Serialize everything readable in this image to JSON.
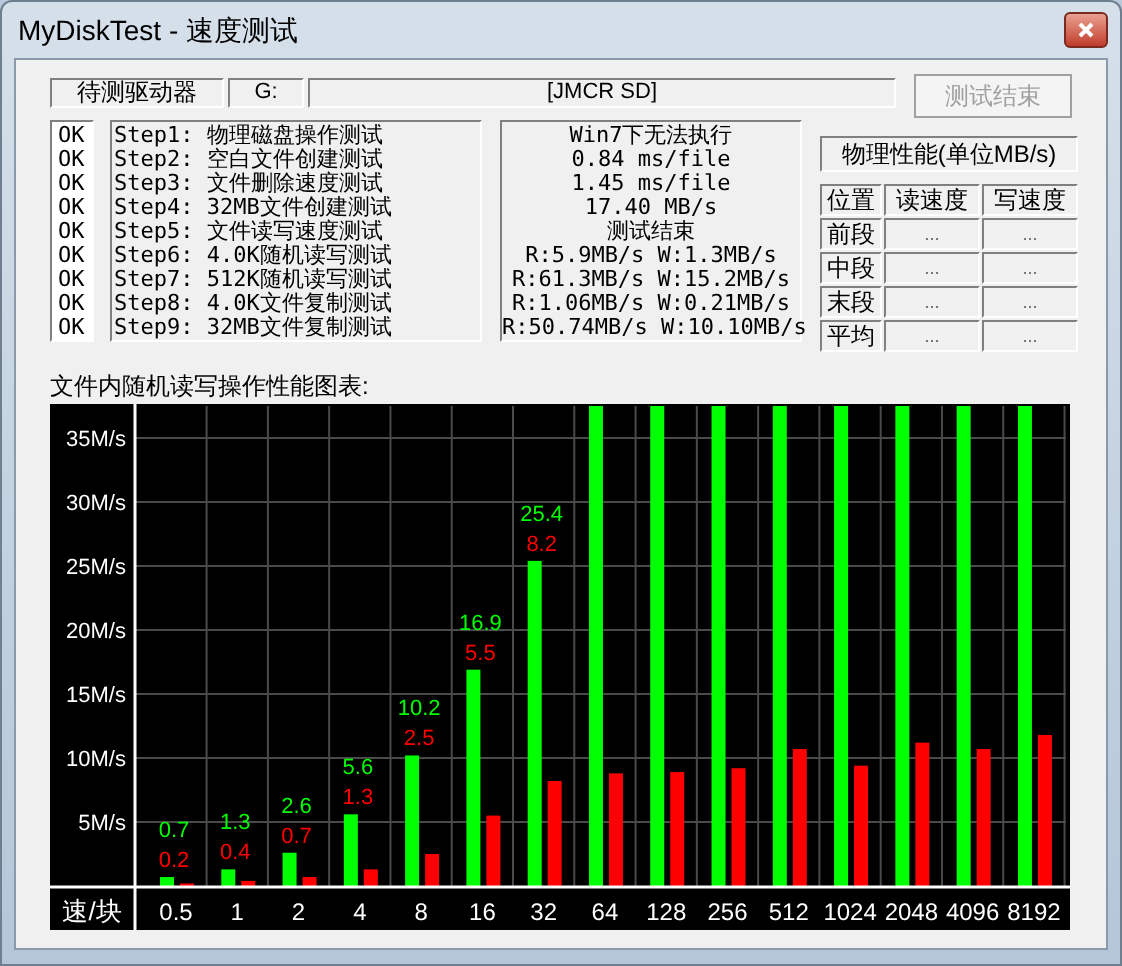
{
  "window": {
    "title": "MyDiskTest - 速度测试"
  },
  "drive": {
    "label": "待测驱动器",
    "letter": "G:",
    "name": "[JMCR SD]"
  },
  "stop_button": {
    "label": "测试结束",
    "disabled": true
  },
  "steps": [
    {
      "status": "OK",
      "name": "Step1: 物理磁盘操作测试",
      "result": "Win7下无法执行"
    },
    {
      "status": "OK",
      "name": "Step2: 空白文件创建测试",
      "result": "0.84 ms/file"
    },
    {
      "status": "OK",
      "name": "Step3: 文件删除速度测试",
      "result": "1.45 ms/file"
    },
    {
      "status": "OK",
      "name": "Step4: 32MB文件创建测试",
      "result": "17.40 MB/s"
    },
    {
      "status": "OK",
      "name": "Step5: 文件读写速度测试",
      "result": "测试结束"
    },
    {
      "status": "OK",
      "name": "Step6: 4.0K随机读写测试",
      "result": "R:5.9MB/s W:1.3MB/s"
    },
    {
      "status": "OK",
      "name": "Step7: 512K随机读写测试",
      "result": "R:61.3MB/s W:15.2MB/s"
    },
    {
      "status": "OK",
      "name": "Step8: 4.0K文件复制测试",
      "result": "R:1.06MB/s W:0.21MB/s"
    },
    {
      "status": "OK",
      "name": "Step9: 32MB文件复制测试",
      "result": "R:50.74MB/s W:10.10MB/s"
    }
  ],
  "physical": {
    "title": "物理性能(单位MB/s)",
    "columns": [
      "位置",
      "读速度",
      "写速度"
    ],
    "rows": [
      {
        "position": "前段",
        "read": "...",
        "write": "..."
      },
      {
        "position": "中段",
        "read": "...",
        "write": "..."
      },
      {
        "position": "末段",
        "read": "...",
        "write": "..."
      },
      {
        "position": "平均",
        "read": "...",
        "write": "..."
      }
    ]
  },
  "chart_title": "文件内随机读写操作性能图表:",
  "chart": {
    "chart_data": {
      "type": "bar",
      "xlabel": "速/块",
      "categories": [
        "0.5",
        "1",
        "2",
        "4",
        "8",
        "16",
        "32",
        "64",
        "128",
        "256",
        "512",
        "1024",
        "2048",
        "4096",
        "8192"
      ],
      "series": [
        {
          "color": "#00ff00",
          "values": [
            0.7,
            1.3,
            2.6,
            5.6,
            10.2,
            16.9,
            25.4,
            37.5,
            37.5,
            37.5,
            37.5,
            37.5,
            37.5,
            37.5,
            37.5
          ]
        },
        {
          "color": "#ff0000",
          "values": [
            0.2,
            0.4,
            0.7,
            1.3,
            2.5,
            5.5,
            8.2,
            8.8,
            8.9,
            9.2,
            10.7,
            9.4,
            11.2,
            10.7,
            11.8
          ]
        }
      ],
      "ylim": [
        0,
        37.5
      ],
      "yticks": [
        {
          "value": 5,
          "label": "5M/s"
        },
        {
          "value": 10,
          "label": "10M/s"
        },
        {
          "value": 15,
          "label": "15M/s"
        },
        {
          "value": 20,
          "label": "20M/s"
        },
        {
          "value": 25,
          "label": "25M/s"
        },
        {
          "value": 30,
          "label": "30M/s"
        },
        {
          "value": 35,
          "label": "35M/s"
        }
      ],
      "grid": true,
      "value_labels": [
        [
          "0.7",
          "1.3",
          "2.6",
          "5.6",
          "10.2",
          "16.9",
          "25.4",
          null,
          null,
          null,
          null,
          null,
          null,
          null,
          null
        ],
        [
          "0.2",
          "0.4",
          "0.7",
          "1.3",
          "2.5",
          "5.5",
          "8.2",
          null,
          null,
          null,
          null,
          null,
          null,
          null,
          null
        ]
      ]
    }
  }
}
